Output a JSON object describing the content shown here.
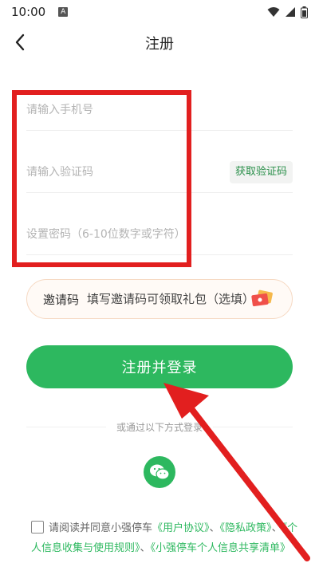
{
  "status_bar": {
    "time": "10:00",
    "notification_letter": "A"
  },
  "nav": {
    "title": "注册"
  },
  "form": {
    "phone_placeholder": "请输入手机号",
    "code_placeholder": "请输入验证码",
    "get_code_label": "获取验证码",
    "password_placeholder": "设置密码（6-10位数字或字符）"
  },
  "invite": {
    "label": "邀请码",
    "placeholder": "填写邀请码可领取礼包（选填）"
  },
  "register_button": "注册并登录",
  "other_login": "或通过以下方式登录",
  "agreement": {
    "prefix": "请阅读并同意小强停车",
    "link_user": "《用户协议》",
    "sep1": "、",
    "link_privacy": "《隐私政策》",
    "sep2": "、",
    "link_personal": "《个人信息收集与使用规则》",
    "sep3": "、",
    "link_xq": "《小强停车个人信息共享清单》"
  },
  "colors": {
    "brand_green": "#2db85f",
    "highlight_red": "#e21f1f"
  }
}
